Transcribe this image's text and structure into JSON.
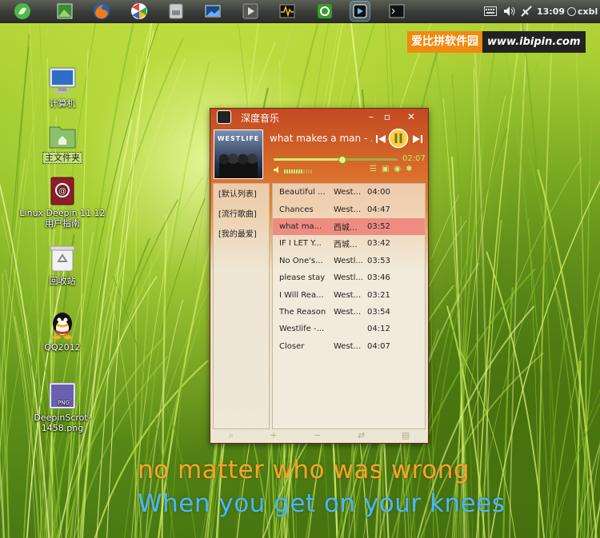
{
  "watermark": {
    "cn": "爱比拼软件园",
    "en": "www.ibipin.com"
  },
  "panel": {
    "launchers": [
      "deepin-menu-icon",
      "picture-viewer-icon",
      "firefox-icon",
      "picasa-icon",
      "files-icon",
      "image-icon",
      "media-play-icon",
      "system-monitor-icon",
      "software-center-icon",
      "deepin-music-icon",
      "terminal-icon"
    ],
    "tray": {
      "keyboard_icon": "keyboard-icon",
      "volume_icon": "volume-icon",
      "network_icon": "network-icon",
      "time": "13:09",
      "user": "cxbl"
    }
  },
  "desktop": {
    "icons": [
      {
        "label": "计算机",
        "icon": "computer-icon"
      },
      {
        "label": "主文件夹",
        "icon": "home-folder-icon",
        "selected": true
      },
      {
        "label": "Linux Deepin 11.12 用户指南",
        "icon": "user-guide-icon"
      },
      {
        "label": "回收站",
        "icon": "trash-icon"
      },
      {
        "label": "QQ2012",
        "icon": "qq-icon"
      },
      {
        "label": "DeepinScrot-1458.png",
        "icon": "png-file-icon"
      }
    ]
  },
  "player": {
    "title": "深度音乐",
    "album_text": "WESTLIFE",
    "now_playing": "what makes a man - ...",
    "elapsed": "02:07",
    "progress": 0.55,
    "volume": 0.7,
    "sidebar": [
      "[默认列表]",
      "[流行歌曲]",
      "[我的最爱]"
    ],
    "tracks": [
      {
        "title": "Beautiful ...",
        "artist": "West...",
        "duration": "04:00"
      },
      {
        "title": "Chances",
        "artist": "West...",
        "duration": "04:47"
      },
      {
        "title": "what ma...",
        "artist": "西城...",
        "duration": "03:52",
        "selected": true
      },
      {
        "title": "IF I LET Y...",
        "artist": "西城...",
        "duration": "03:42"
      },
      {
        "title": "No One's...",
        "artist": "Westl...",
        "duration": "03:53"
      },
      {
        "title": "please stay",
        "artist": "Westl...",
        "duration": "03:46"
      },
      {
        "title": "I Will Rea...",
        "artist": "West...",
        "duration": "03:21"
      },
      {
        "title": "The Reason",
        "artist": "West...",
        "duration": "03:54"
      },
      {
        "title": "Westlife -...",
        "artist": "",
        "duration": "04:12"
      },
      {
        "title": "Closer",
        "artist": "West...",
        "duration": "04:07"
      }
    ]
  },
  "lyrics": {
    "line1": "no matter who was wrong",
    "line2": "When you get on your knees"
  },
  "colors": {
    "lyric_current": "#ffa226",
    "lyric_next": "#46b8ff",
    "accent": "#c8f070"
  }
}
